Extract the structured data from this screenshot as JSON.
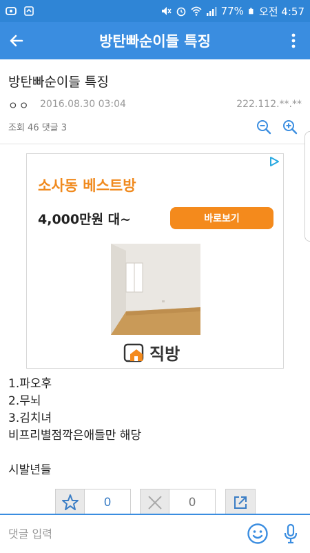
{
  "status_bar": {
    "battery": "77%",
    "clock": "오전 4:57"
  },
  "app_bar": {
    "title": "방탄빠순이들 특징"
  },
  "post": {
    "title": "방탄빠순이들 특징",
    "author": "ㅇㅇ",
    "date": "2016.08.30 03:04",
    "ip": "222.112.**.**",
    "stats": "조회 46 댓글 3"
  },
  "ad": {
    "headline": "소사동 베스트방",
    "price": "4,000만원 대~",
    "cta": "바로보기",
    "logo_text": "직방",
    "colors": {
      "headline": "#f08a1e",
      "cta": "#f48a1c"
    }
  },
  "body": {
    "lines": [
      "1.파오후",
      "2.무뇌",
      "3.김치녀",
      "비프리별점깍은애들만 해당"
    ],
    "extra": "시발년들"
  },
  "votes": {
    "recommend_count": "0",
    "dislike_count": "0"
  },
  "comment": {
    "placeholder": "댓글 입력"
  },
  "colors": {
    "primary": "#3a8de0",
    "status": "#2f85d6"
  }
}
